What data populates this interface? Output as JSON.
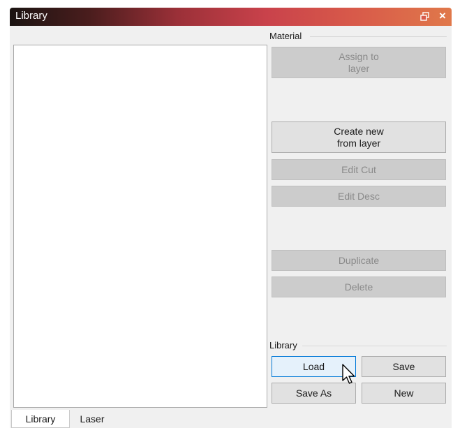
{
  "window": {
    "title": "Library"
  },
  "material_group": {
    "label": "Material",
    "buttons": {
      "assign": "Assign to\nlayer",
      "create_new": "Create new\nfrom layer",
      "edit_cut": "Edit Cut",
      "edit_desc": "Edit Desc",
      "duplicate": "Duplicate",
      "delete": "Delete"
    }
  },
  "library_group": {
    "label": "Library",
    "buttons": {
      "load": "Load",
      "save": "Save",
      "save_as": "Save As",
      "new": "New"
    }
  },
  "tabs": [
    {
      "label": "Library",
      "active": true
    },
    {
      "label": "Laser",
      "active": false
    }
  ],
  "icons": {
    "float": "float-window-icon",
    "close": "close-icon",
    "cursor": "mouse-pointer-icon"
  },
  "colors": {
    "title_gradient_start": "#1b1412",
    "title_gradient_end": "#e0784a",
    "disabled_button": "#cccccc",
    "hover_button": "#e5f1fb",
    "hover_border": "#0078d7"
  }
}
